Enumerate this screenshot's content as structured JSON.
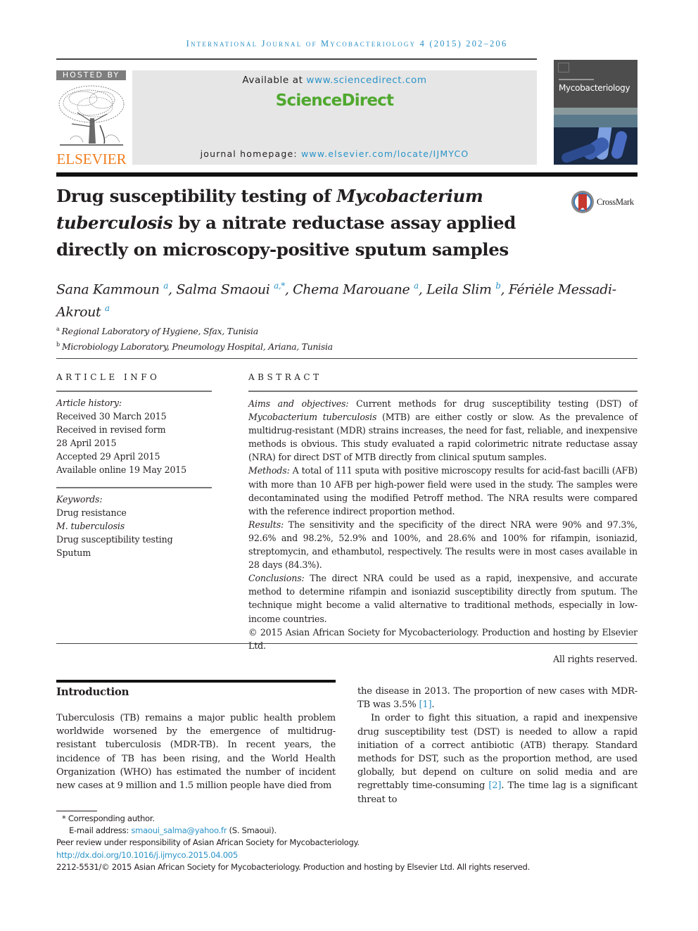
{
  "journal_header": {
    "running_title": "International Journal of Mycobacteriology 4 (2015) 202–206"
  },
  "masthead": {
    "hosted_by": "HOSTED BY",
    "publisher": "ELSEVIER",
    "available_at_prefix": "Available at ",
    "available_at_url": "www.sciencedirect.com",
    "sciencedirect_logo": "ScienceDirect",
    "homepage_prefix": "journal homepage: ",
    "homepage_url": "www.elsevier.com/locate/IJMYCO",
    "cover_title": "Mycobacteriology",
    "brand_colors": {
      "elsevier_orange": "#f07d1e",
      "sciencedirect_green": "#4fa82e",
      "link_blue": "#2a93c8"
    }
  },
  "article": {
    "title_part1": "Drug susceptibility testing of ",
    "title_italic1": "Mycobacterium tuberculosis",
    "title_part2": " by a nitrate reductase assay applied directly on microscopy-positive sputum samples",
    "crossmark_label": "CrossMark",
    "authors": [
      {
        "name": "Sana Kammoun",
        "sup": "a"
      },
      {
        "name": "Salma Smaoui",
        "sup": "a,*"
      },
      {
        "name": "Chema Marouane",
        "sup": "a"
      },
      {
        "name": "Leila Slim",
        "sup": "b"
      },
      {
        "name": "Fériėle Messadi-Akrout",
        "sup": "a"
      }
    ],
    "affiliations": [
      {
        "key": "a",
        "text": "Regional Laboratory of Hygiene, Sfax, Tunisia"
      },
      {
        "key": "b",
        "text": "Microbiology Laboratory, Pneumology Hospital, Ariana, Tunisia"
      }
    ]
  },
  "article_info": {
    "heading": "ARTICLE INFO",
    "history_label": "Article history:",
    "history": [
      "Received 30 March 2015",
      "Received in revised form",
      "28 April 2015",
      "Accepted 29 April 2015",
      "Available online 19 May 2015"
    ],
    "keywords_label": "Keywords:",
    "keywords": [
      "Drug resistance",
      "M. tuberculosis",
      "Drug susceptibility testing",
      "Sputum"
    ]
  },
  "abstract": {
    "heading": "ABSTRACT",
    "aims_label": "Aims and objectives:",
    "aims_text_1": " Current methods for drug susceptibility testing (DST) of ",
    "aims_italic": "Mycobacterium tuberculosis",
    "aims_text_2": " (MTB) are either costly or slow. As the prevalence of multidrug-resistant (MDR) strains increases, the need for fast, reliable, and inexpensive methods is obvious. This study evaluated a rapid colorimetric nitrate reductase assay (NRA) for direct DST of MTB directly from clinical sputum samples.",
    "methods_label": "Methods:",
    "methods_text": " A total of 111 sputa with positive microscopy results for acid-fast bacilli (AFB) with more than 10 AFB per high-power field were used in the study. The samples were decontaminated using the modified Petroff method. The NRA results were compared with the reference indirect proportion method.",
    "results_label": "Results:",
    "results_text": " The sensitivity and the specificity of the direct NRA were 90% and 97.3%, 92.6% and 98.2%, 52.9% and 100%, and 28.6% and 100% for rifampin, isoniazid, streptomycin, and ethambutol, respectively. The results were in most cases available in 28 days (84.3%).",
    "conclusions_label": "Conclusions:",
    "conclusions_text": " The direct NRA could be used as a rapid, inexpensive, and accurate method to determine rifampin and isoniazid susceptibility directly from sputum. The technique might become a valid alternative to traditional methods, especially in low-income countries.",
    "copyright": "© 2015 Asian African Society for Mycobacteriology. Production and hosting by Elsevier Ltd.",
    "rights": "All rights reserved."
  },
  "introduction": {
    "heading": "Introduction",
    "para1": "Tuberculosis (TB) remains a major public health problem worldwide worsened by the emergence of multidrug-resistant tuberculosis (MDR-TB). In recent years, the incidence of TB has been rising, and the World Health Organization (WHO) has estimated the number of incident new cases at 9 million and 1.5 million people have died from",
    "para1_cont": "the disease in 2013. The proportion of new cases with MDR-TB was 3.5% ",
    "ref1": "[1]",
    "para1_end": ".",
    "para2_a": "In order to fight this situation, a rapid and inexpensive drug susceptibility test (DST) is needed to allow a rapid initiation of a correct antibiotic (ATB) therapy. Standard methods for DST, such as the proportion method, are used globally, but depend on culture on solid media and are regrettably time-consuming ",
    "ref2": "[2]",
    "para2_b": ". The time lag is a significant threat to"
  },
  "footnotes": {
    "corresponding": "* Corresponding author.",
    "email_label": "E-mail address: ",
    "email": "smaoui_salma@yahoo.fr",
    "email_suffix": " (S. Smaoui).",
    "peer_review": "Peer review under responsibility of Asian African Society for Mycobacteriology.",
    "doi": "http://dx.doi.org/10.1016/j.ijmyco.2015.04.005",
    "issn_copyright": "2212-5531/© 2015 Asian African Society for Mycobacteriology. Production and hosting by Elsevier Ltd. All rights reserved."
  }
}
